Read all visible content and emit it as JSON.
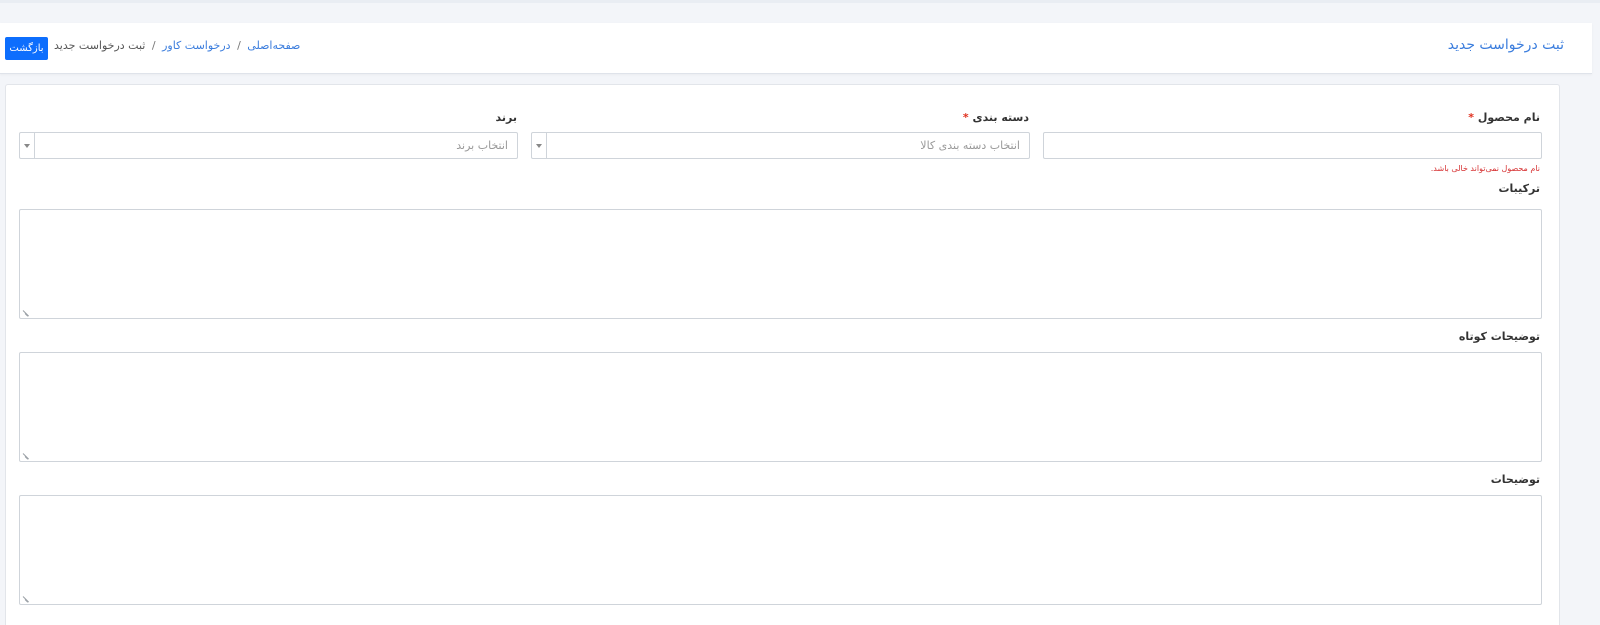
{
  "header": {
    "title": "ثبت درخواست جدید",
    "breadcrumb": {
      "home": "صفحه‌اصلی",
      "separator": "/",
      "parent": "درخواست کاور",
      "current": "ثبت درخواست جدید"
    },
    "back_button": "بازگشت"
  },
  "form": {
    "product_name": {
      "label": "نام محصول",
      "required_mark": "*",
      "value": "",
      "error": "نام محصول نمی‌تواند خالی باشد."
    },
    "category": {
      "label": "دسته بندی",
      "required_mark": "*",
      "placeholder": "انتخاب دسته بندی کالا"
    },
    "brand": {
      "label": "برند",
      "placeholder": "انتخاب برند"
    },
    "ingredients": {
      "label": "ترکیبات",
      "value": ""
    },
    "short_description": {
      "label": "توضیحات کوتاه",
      "value": ""
    },
    "description": {
      "label": "توضیحات",
      "value": ""
    }
  },
  "colors": {
    "accent": "#3b7ddd",
    "button": "#0d6efd",
    "error": "#d63031"
  }
}
